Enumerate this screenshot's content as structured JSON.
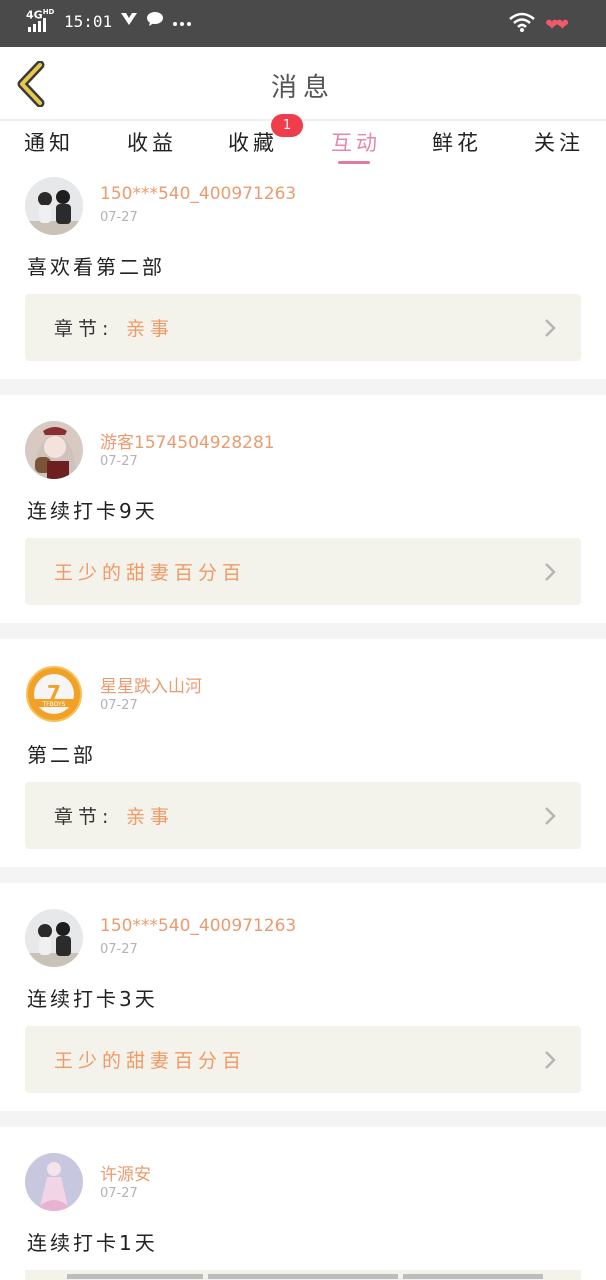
{
  "status_bar": {
    "network": "4G",
    "network_sup": "HD",
    "time": "15:01",
    "icons": [
      "signal-icon",
      "vpn-icon",
      "chat-icon",
      "more-icon",
      "wifi-icon",
      "hearts-icon"
    ]
  },
  "header": {
    "title": "消息",
    "back_icon": "back-chevron-icon"
  },
  "tabs": [
    {
      "label": "通知"
    },
    {
      "label": "收益"
    },
    {
      "label": "收藏",
      "badge": "1"
    },
    {
      "label": "互动",
      "active": true
    },
    {
      "label": "鲜花"
    },
    {
      "label": "关注"
    }
  ],
  "feed": [
    {
      "username": "150***540_400971263",
      "date": "07-27",
      "comment": "喜欢看第二部",
      "ref_label": "章节:",
      "ref_value": "亲事",
      "avatar": "couple-photo-avatar"
    },
    {
      "username": "游客1574504928281",
      "date": "07-27",
      "comment": "连续打卡9天",
      "ref_label": "",
      "ref_value": "王少的甜妻百分百",
      "avatar": "anime-girl-avatar"
    },
    {
      "username": "星星跌入山河",
      "date": "07-27",
      "comment": "第二部",
      "ref_label": "章节:",
      "ref_value": "亲事",
      "avatar": "tfboys-logo-avatar",
      "avatar_text": "TFBOYS"
    },
    {
      "username": "150***540_400971263",
      "date": "07-27",
      "comment": "连续打卡3天",
      "ref_label": "",
      "ref_value": "王少的甜妻百分百",
      "avatar": "couple-photo-avatar"
    },
    {
      "username": "许源安",
      "date": "07-27",
      "comment": "连续打卡1天",
      "avatar": "pink-dress-avatar"
    }
  ],
  "colors": {
    "accent_pink": "#e27b9b",
    "username_orange": "#eb9b6e",
    "ref_orange": "#ef9a66",
    "badge_red": "#ef3d4b",
    "ref_bg": "#f3f3eb"
  }
}
